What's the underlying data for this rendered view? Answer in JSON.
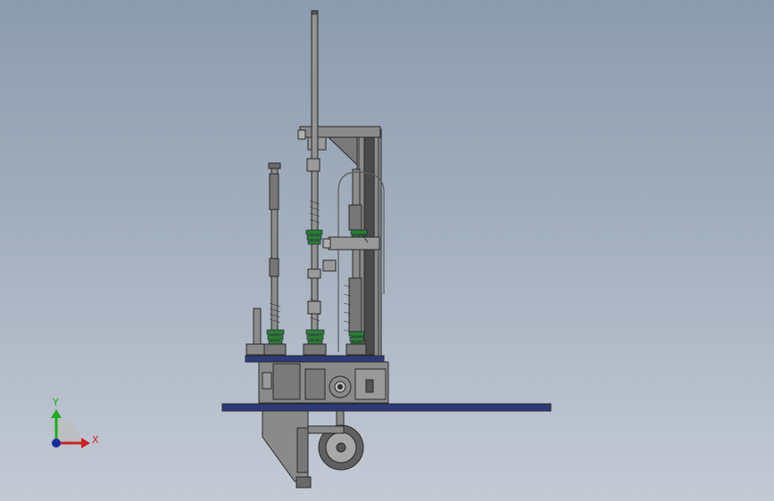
{
  "viewport": {
    "background_top": "#8c9bae",
    "background_bottom": "#c3cad5"
  },
  "model": {
    "part_color": "#7a7a7a",
    "edge_color": "#2a2a2a",
    "plate_color": "#2c3a7a",
    "spring_color": "#2e7d32"
  },
  "triad": {
    "x_label": "X",
    "y_label": "Y",
    "x_color": "#cc2222",
    "y_color": "#22aa22",
    "z_color": "#1a2a9a"
  }
}
